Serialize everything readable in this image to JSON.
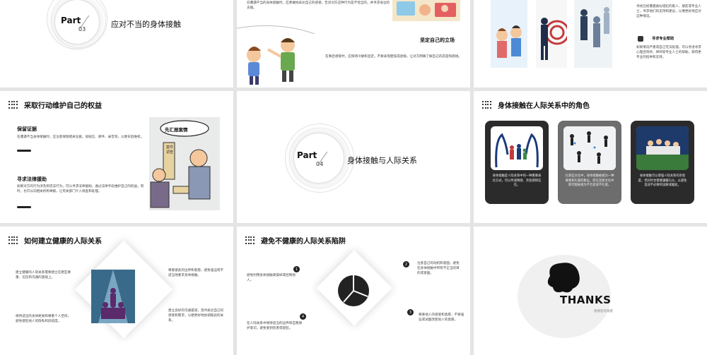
{
  "slide1": {
    "part_label": "Part",
    "part_num": "03",
    "title": "应对不当的身体接触"
  },
  "slide2": {
    "top_text": "向遭遇不当的身体接触时，应勇敢地表达自己的感受，告诉对方这种行为是不恰当的，并寻求身边的支援。",
    "heading": "坚定自己的立场",
    "body": "在事后感受时，应保持冷静和坚定，不要表现胆怯或退缩，让对方明确了解自己的态度和底线。"
  },
  "slide3": {
    "text1": "寻找已经遭遇类似侵犯的家人、朋友或专业人士，寻求他们的支持和建议，以便更好地应对这种情况。",
    "heading": "寻求专业帮助",
    "text2": "如果情况严重或自己无法处理，可以考虑寻求心理咨询师、律师等专业人士的帮助，获得更专业的指导和支持。"
  },
  "slide4": {
    "title": "采取行动维护自己的权益",
    "sec1_heading": "保留证据",
    "sec1_text": "在遭遇不当身体接触时，应注意保留相关证据，如短信、邮件、录音等，以便日后维权。",
    "sec2_heading": "寻求法律援助",
    "sec2_text": "如果对方的行为涉及到违法行为，可以寻求法律援助，通过法律手段维护自己的权益。同时，也可以向相关机构举报，让有关部门介入调查和处理。",
    "sign_text": "先汇报案情",
    "banner_text": "案件调查"
  },
  "slide5": {
    "part_label": "Part",
    "part_num": "04",
    "title": "身体接触与人际关系"
  },
  "slide6": {
    "title": "身体接触在人际关系中的角色",
    "card1": "身体接触是人际关系中的一种重要表达方式，可以传递情感、亲密感和信任。",
    "card2": "在某些文化中，身体接触被视为一种尊重和礼貌的象征，而在其他文化中则可能被视为不合适或不礼貌。",
    "card3": "身体接触可以增强人际关系的亲密度，但同时也需要遵循礼仪，以避免造成不必要的误解或尴尬。"
  },
  "slide7": {
    "title": "如何建立健康的人际关系",
    "tl": "建立健康的人际关系需要建立在相互尊重、信任和沟通的基础上。",
    "bl": "保持适当的身体距离和尊重个人空间，避免侵犯他人的隐私和舒适度。",
    "tr": "尊重彼此的边界和意愿，避免强迫或不适当地要求身体接触。",
    "br": "建立良好的沟通渠道，及时表达自己的感受和需求，以便更好地协调彼此的关系。"
  },
  "slide8": {
    "title": "避免不健康的人际关系陷阱",
    "n1": "1",
    "t1": "避免利用身体接触来操纵或控制他人。",
    "n2": "2",
    "t2": "注意自己的动机和意图，避免在身体接触中带有不正当的目的或意图。",
    "n3": "3",
    "t3": "尊重他人的感受和意愿，不要强迫或试图改变他人的意愿。",
    "n4": "4",
    "t4": "在人际关系中保持适当的边界和自我保护意识，避免受到伤害或侵犯。"
  },
  "slide9": {
    "thanks": "THANKS",
    "sub": "感谢您的观看"
  }
}
